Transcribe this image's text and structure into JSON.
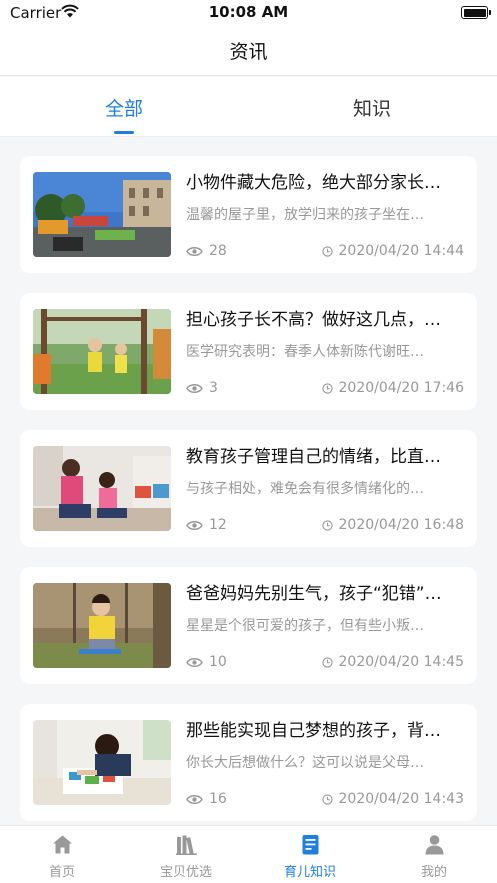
{
  "status_bar": {
    "carrier": "Carrier",
    "time": "10:08 AM"
  },
  "nav": {
    "title": "资讯"
  },
  "tabs": [
    {
      "label": "全部",
      "active": true
    },
    {
      "label": "知识",
      "active": false
    }
  ],
  "articles": [
    {
      "title": "小物件藏大危险，绝大部分家长…",
      "summary": "温馨的屋子里，放学归来的孩子坐在…",
      "views": "28",
      "date": "2020/04/20 14:44",
      "image": "playground-photo"
    },
    {
      "title": "担心孩子长不高？做好这几点，…",
      "summary": "医学研究表明：春季人体新陈代谢旺…",
      "views": "3",
      "date": "2020/04/20 17:46",
      "image": "kids-climbing-photo"
    },
    {
      "title": "教育孩子管理自己的情绪，比直…",
      "summary": "与孩子相处，难免会有很多情绪化的…",
      "views": "12",
      "date": "2020/04/20 16:48",
      "image": "mother-child-photo"
    },
    {
      "title": "爸爸妈妈先别生气，孩子“犯错”…",
      "summary": "星星是个很可爱的孩子，但有些小叛…",
      "views": "10",
      "date": "2020/04/20 14:45",
      "image": "boy-swing-photo"
    },
    {
      "title": "那些能实现自己梦想的孩子，背…",
      "summary": "你长大后想做什么？这可以说是父母…",
      "views": "16",
      "date": "2020/04/20 14:43",
      "image": "boy-drawing-photo"
    }
  ],
  "tab_bar": {
    "items": [
      {
        "label": "首页",
        "icon": "home-icon",
        "active": false
      },
      {
        "label": "宝贝优选",
        "icon": "books-icon",
        "active": false
      },
      {
        "label": "育儿知识",
        "icon": "document-icon",
        "active": true
      },
      {
        "label": "我的",
        "icon": "person-icon",
        "active": false
      }
    ]
  },
  "colors": {
    "accent": "#1e7fdc",
    "inactive": "#999999",
    "background": "#f5f6f8"
  }
}
